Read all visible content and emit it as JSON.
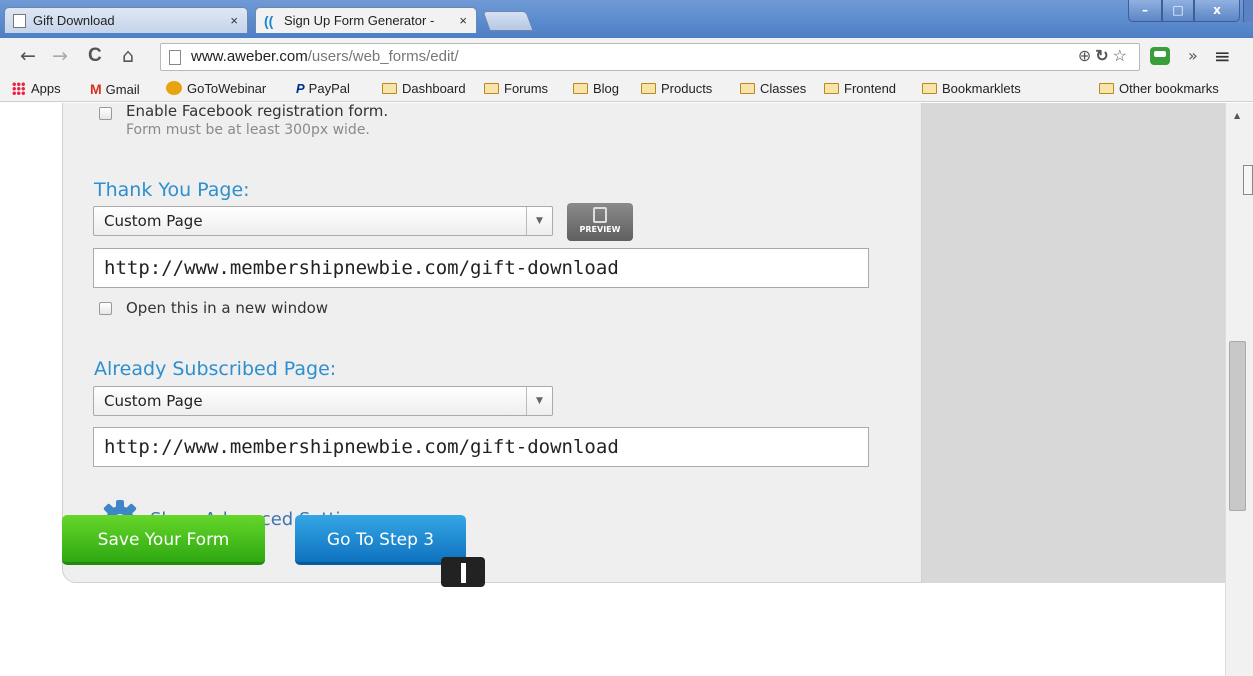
{
  "browser": {
    "tabs": [
      {
        "title": "Gift Download",
        "active": false
      },
      {
        "title": "Sign Up Form Generator -",
        "active": true
      }
    ],
    "window_controls": {
      "minimize": "–",
      "maximize": "□",
      "close": "x"
    },
    "nav": {
      "back": "←",
      "forward": "→",
      "reload": "C",
      "home": "⌂"
    },
    "address": {
      "host": "www.aweber.com",
      "path": "/users/web_forms/edit/"
    },
    "toolbar_icons": [
      "zoom-icon",
      "sync-icon",
      "star-icon"
    ],
    "overflow": "»",
    "menu": "≡"
  },
  "bookmarks": {
    "apps": "Apps",
    "items": [
      {
        "label": "Gmail",
        "icon": "gmail-icon"
      },
      {
        "label": "GoToWebinar",
        "icon": "gotowebinar-icon"
      },
      {
        "label": "PayPal",
        "icon": "paypal-icon"
      },
      {
        "label": "Dashboard",
        "icon": "folder-icon"
      },
      {
        "label": "Forums",
        "icon": "folder-icon"
      },
      {
        "label": "Blog",
        "icon": "folder-icon"
      },
      {
        "label": "Products",
        "icon": "folder-icon"
      },
      {
        "label": "Classes",
        "icon": "folder-icon"
      },
      {
        "label": "Frontend",
        "icon": "folder-icon"
      },
      {
        "label": "Bookmarklets",
        "icon": "folder-icon"
      }
    ],
    "other": "Other bookmarks"
  },
  "form": {
    "facebook_option": {
      "label": "Enable Facebook registration form.",
      "checked": false
    },
    "facebook_hint": "Form must be at least 300px wide.",
    "thank_you": {
      "title": "Thank You Page:",
      "select_value": "Custom Page",
      "preview_label": "PREVIEW",
      "url": "http://www.membershipnewbie.com/gift-download",
      "new_window_label": "Open this in a new window",
      "new_window_checked": false
    },
    "already_subscribed": {
      "title": "Already Subscribed Page:",
      "select_value": "Custom Page",
      "url": "http://www.membershipnewbie.com/gift-download"
    },
    "advanced_link": "Show Advanced Settings"
  },
  "actions": {
    "save": "Save Your Form",
    "next": "Go To Step 3"
  },
  "colors": {
    "section_title": "#2d8fcf",
    "save_button": "#3cb519",
    "next_button": "#1a86d0",
    "link": "#3f74b0"
  }
}
